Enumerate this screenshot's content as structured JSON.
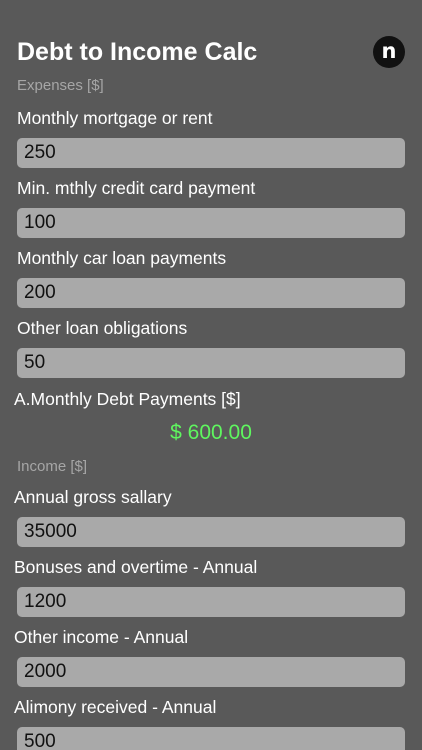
{
  "app": {
    "title": "Debt to Income Calc",
    "logo_letter": "n"
  },
  "expenses": {
    "section_label": "Expenses [$]",
    "fields": [
      {
        "label": "Monthly mortgage or rent",
        "value": "250"
      },
      {
        "label": "Min. mthly credit card payment",
        "value": "100"
      },
      {
        "label": "Monthly car loan payments",
        "value": "200"
      },
      {
        "label": "Other loan obligations",
        "value": "50"
      }
    ],
    "total_label": "A.Monthly Debt Payments [$]",
    "total_value": "$ 600.00"
  },
  "income": {
    "section_label": "Income [$]",
    "fields": [
      {
        "label": "Annual gross sallary",
        "value": "35000"
      },
      {
        "label": "Bonuses and overtime - Annual",
        "value": "1200"
      },
      {
        "label": "Other income - Annual",
        "value": "2000"
      },
      {
        "label": "Alimony received - Annual",
        "value": "500"
      }
    ]
  },
  "colors": {
    "background": "#595959",
    "field_background": "#a9a9a9",
    "total_text": "#5ff65f",
    "section_text": "#a6a6a6"
  }
}
